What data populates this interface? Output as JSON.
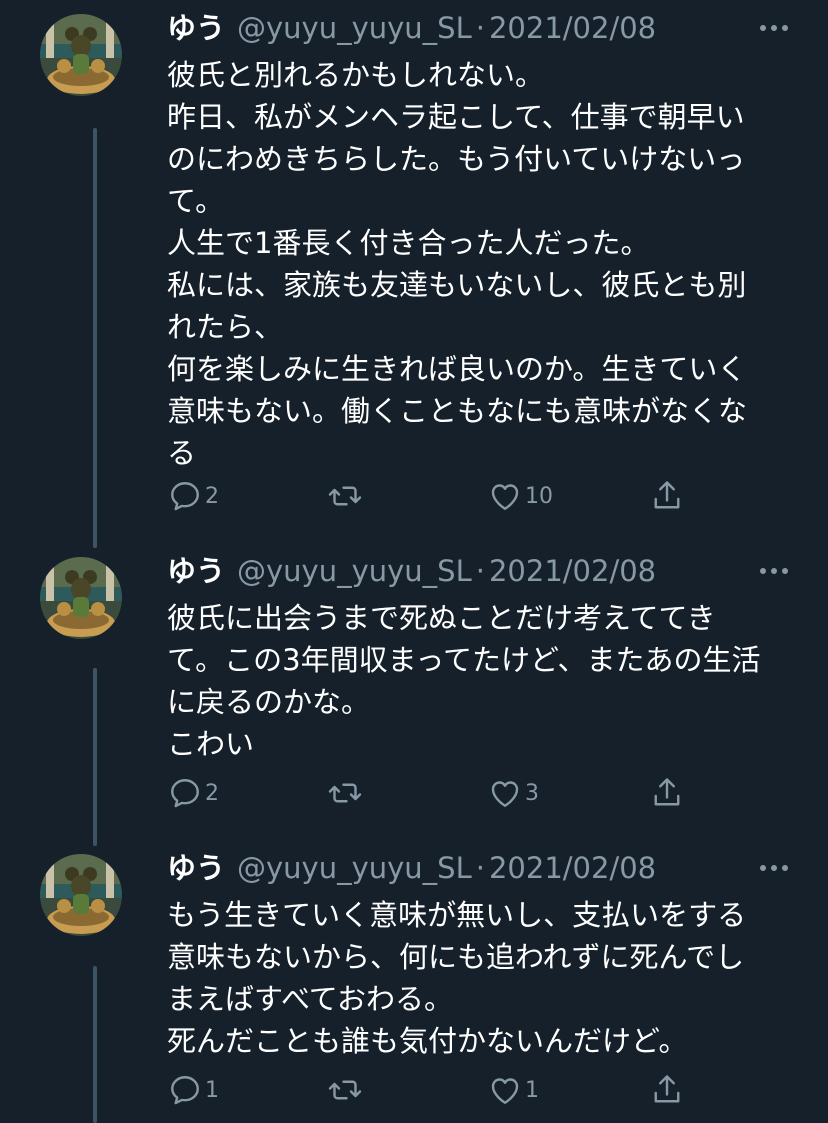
{
  "tweets": [
    {
      "name": "ゆう",
      "handle": "@yuyu_yuyu_SL",
      "separator": "·",
      "date": "2021/02/08",
      "text": "彼氏と別れるかもしれない。\n昨日、私がメンヘラ起こして、仕事で朝早い\nのにわめきちらした。もう付いていけないっ\nて。\n人生で1番長く付き合った人だった。\n私には、家族も友達もいないし、彼氏とも別\nれたら、\n何を楽しみに生きれば良いのか。生きていく\n意味もない。働くこともなにも意味がなくな\nる",
      "replies": "2",
      "retweets": "",
      "likes": "10"
    },
    {
      "name": "ゆう",
      "handle": "@yuyu_yuyu_SL",
      "separator": "·",
      "date": "2021/02/08",
      "text": "彼氏に出会うまで死ぬことだけ考えててき\nて。この3年間収まってたけど、またあの生活\nに戻るのかな。\nこわい",
      "replies": "2",
      "retweets": "",
      "likes": "3"
    },
    {
      "name": "ゆう",
      "handle": "@yuyu_yuyu_SL",
      "separator": "·",
      "date": "2021/02/08",
      "text": "もう生きていく意味が無いし、支払いをする\n意味もないから、何にも追われずに死んでし\nまえばすべておわる。\n死んだことも誰も気付かないんだけど。",
      "replies": "1",
      "retweets": "",
      "likes": "1"
    }
  ],
  "icons": {
    "reply": "reply-icon",
    "retweet": "retweet-icon",
    "like": "like-icon",
    "share": "share-icon",
    "more": "more-icon"
  },
  "colors": {
    "background": "#15202b",
    "secondary_text": "#8899a6",
    "thread_line": "#3d5466"
  }
}
